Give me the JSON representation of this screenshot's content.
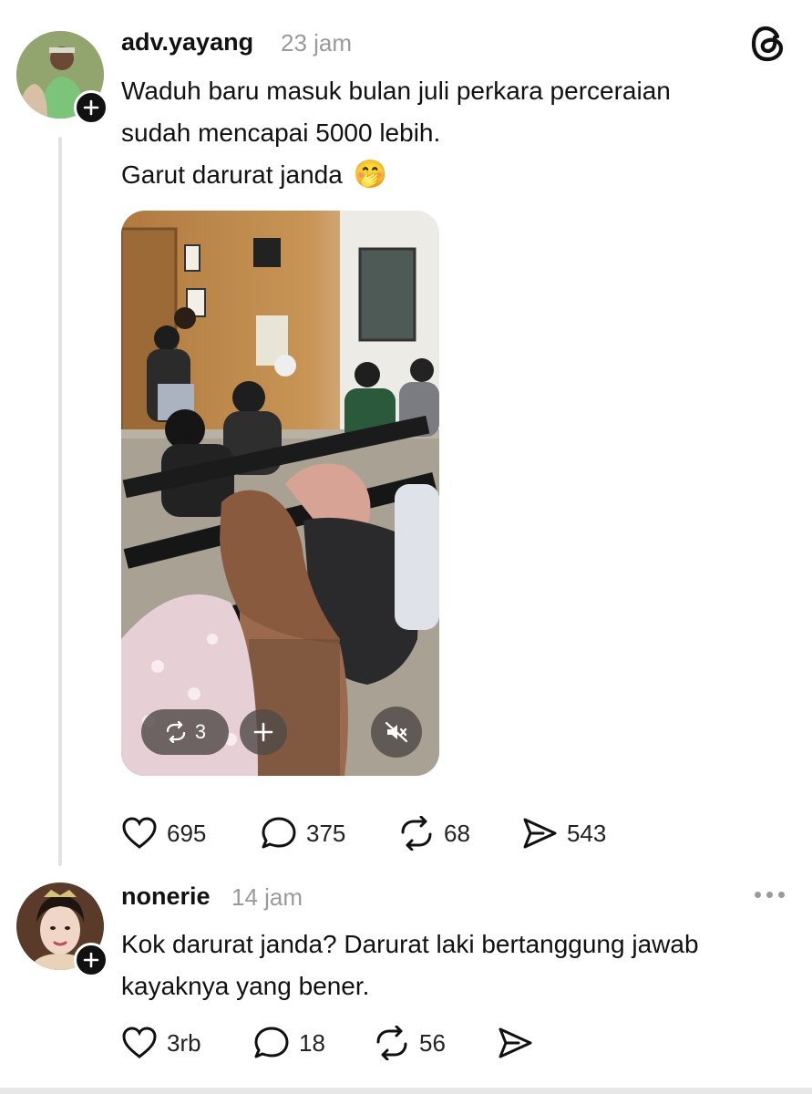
{
  "post": {
    "username": "adv.yayang",
    "time": "23 jam",
    "text_line1": "Waduh baru masuk bulan juli perkara perceraian",
    "text_line2": "sudah mencapai 5000 lebih.",
    "text_line3": "Garut darurat janda",
    "emoji": "🤭",
    "media": {
      "repost_count": "3"
    },
    "actions": {
      "likes": "695",
      "comments": "375",
      "reposts": "68",
      "shares": "543"
    }
  },
  "reply": {
    "username": "nonerie",
    "time": "14 jam",
    "text_line1": "Kok darurat janda? Darurat laki bertanggung jawab",
    "text_line2": "kayaknya yang bener.",
    "actions": {
      "likes": "3rb",
      "comments": "18",
      "reposts": "56"
    }
  },
  "icons": {
    "app_logo": "threads-logo-icon",
    "follow": "plus-icon",
    "like": "heart-icon",
    "comment": "comment-bubble-icon",
    "repost": "repost-icon",
    "share": "send-icon",
    "mute": "speaker-muted-icon",
    "more": "more-dots-icon"
  }
}
